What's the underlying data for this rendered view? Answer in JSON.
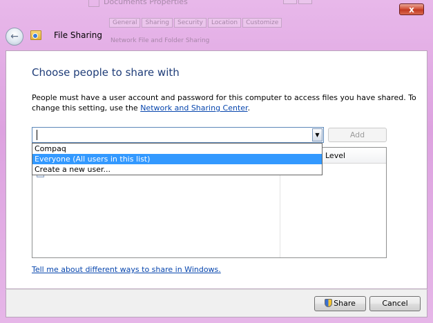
{
  "window": {
    "background_title": "Documents Properties",
    "background_tabs": [
      "General",
      "Sharing",
      "Security",
      "Location",
      "Customize"
    ],
    "background_subtitle": "Network File and Folder Sharing",
    "close_symbol": "x",
    "back_symbol": "←",
    "title": "File Sharing"
  },
  "main": {
    "heading": "Choose people to share with",
    "info_text": "People must have a user account and password for this computer to access files you have shared.  To change this setting, use the",
    "info_link": "Network and Sharing Center",
    "info_end": ".",
    "input_value": "",
    "combo_arrow": "▼",
    "add_label": "Add",
    "dropdown_options": [
      {
        "label": "Compaq",
        "selected": false
      },
      {
        "label": "Everyone (All users in this list)",
        "selected": true
      },
      {
        "label": "Create a new user...",
        "selected": false
      }
    ],
    "column_level": "Level",
    "help_link": "Tell me about different ways to share in Windows."
  },
  "footer": {
    "share_label": "Share",
    "cancel_label": "Cancel"
  },
  "colors": {
    "accent": "#1e3c78",
    "selection": "#3399ff",
    "link": "#0645ad"
  }
}
